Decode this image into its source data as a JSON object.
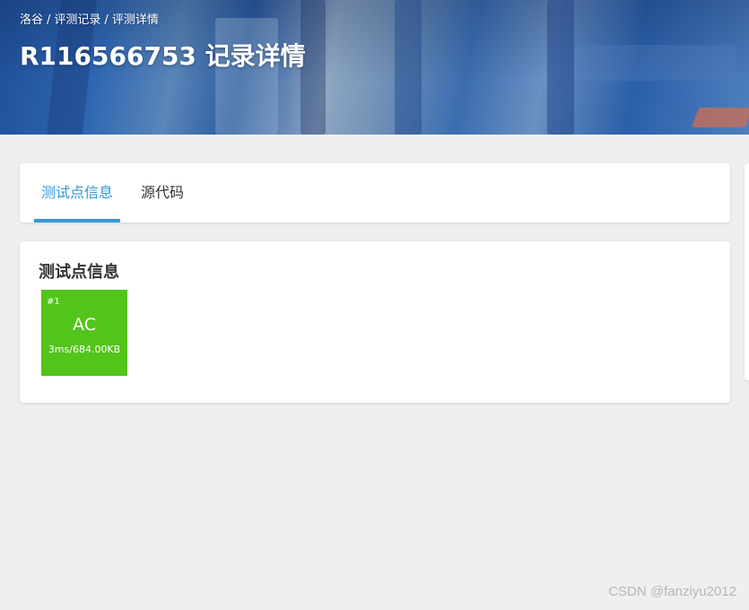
{
  "breadcrumb": {
    "items": [
      "洛谷",
      "评测记录",
      "评测详情"
    ],
    "separator": "/"
  },
  "page": {
    "title": "R116566753 记录详情"
  },
  "tabs": [
    {
      "label": "测试点信息",
      "active": true
    },
    {
      "label": "源代码",
      "active": false
    }
  ],
  "testcases_section": {
    "title": "测试点信息",
    "cases": [
      {
        "id": "#1",
        "status": "AC",
        "detail": "3ms/684.00KB",
        "color": "#52c41a"
      }
    ]
  },
  "watermark": "CSDN @fanziyu2012",
  "colors": {
    "accent": "#3498db",
    "ac_green": "#52c41a",
    "background": "#efefef"
  }
}
